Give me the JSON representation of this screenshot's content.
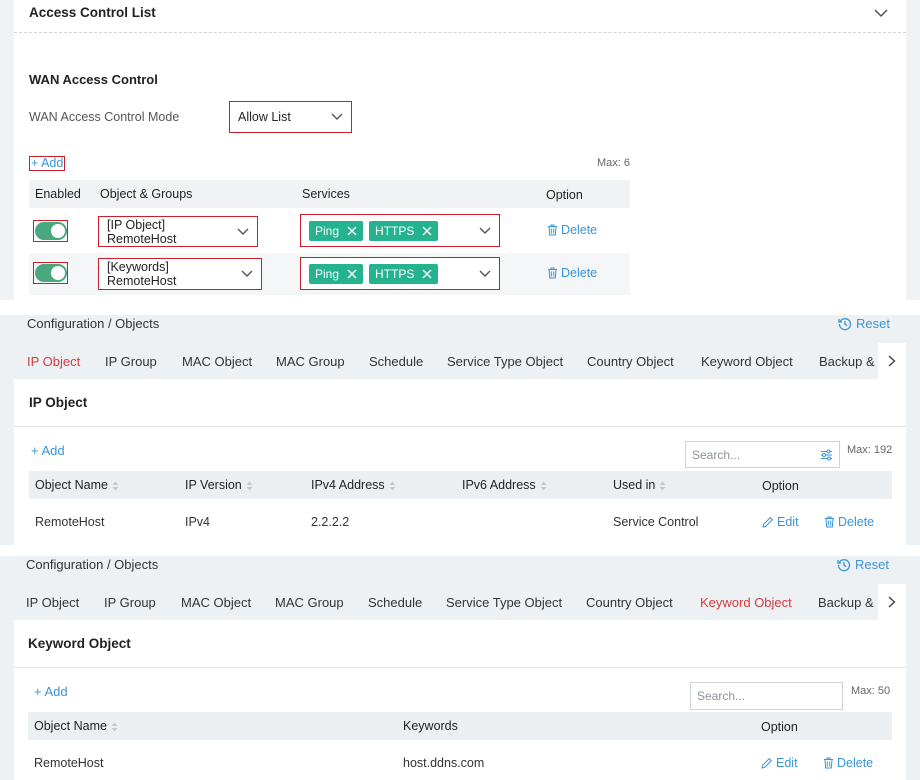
{
  "acl": {
    "title": "Access Control List",
    "section_title": "WAN Access Control",
    "mode_label": "WAN Access Control Mode",
    "mode_value": "Allow List",
    "add_label": "+ Add",
    "max_label": "Max: 6",
    "headers": [
      "Enabled",
      "Object & Groups",
      "Services",
      "Option"
    ],
    "rows": [
      {
        "object": "[IP Object] RemoteHost",
        "services": [
          "Ping",
          "HTTPS"
        ],
        "delete": "Delete"
      },
      {
        "object": "[Keywords] RemoteHost",
        "services": [
          "Ping",
          "HTTPS"
        ],
        "delete": "Delete"
      }
    ]
  },
  "ip_page": {
    "breadcrumb": "Configuration / Objects",
    "reset": "Reset",
    "tabs": [
      "IP Object",
      "IP Group",
      "MAC Object",
      "MAC Group",
      "Schedule",
      "Service Type Object",
      "Country Object",
      "Keyword Object",
      "Backup & I"
    ],
    "section_title": "IP Object",
    "add_label": "+ Add",
    "search_placeholder": "Search...",
    "max_label": "Max: 192",
    "headers": [
      "Object Name",
      "IP Version",
      "IPv4 Address",
      "IPv6 Address",
      "Used in",
      "Option"
    ],
    "rows": [
      {
        "name": "RemoteHost",
        "version": "IPv4",
        "ipv4": "2.2.2.2",
        "ipv6": "",
        "used_in": "Service Control",
        "edit": "Edit",
        "delete": "Delete"
      }
    ]
  },
  "kw_page": {
    "breadcrumb": "Configuration / Objects",
    "reset": "Reset",
    "tabs": [
      "IP Object",
      "IP Group",
      "MAC Object",
      "MAC Group",
      "Schedule",
      "Service Type Object",
      "Country Object",
      "Keyword Object",
      "Backup & I"
    ],
    "section_title": "Keyword Object",
    "add_label": "+ Add",
    "search_placeholder": "Search...",
    "max_label": "Max: 50",
    "headers": [
      "Object Name",
      "Keywords",
      "Option"
    ],
    "rows": [
      {
        "name": "RemoteHost",
        "keywords": "host.ddns.com",
        "edit": "Edit",
        "delete": "Delete"
      }
    ]
  },
  "colors": {
    "accent": "#3a95d6",
    "tab_active": "#d33b3f",
    "toggle_on": "#4aa87f",
    "tag": "#25b28e",
    "highlight": "#c81e2d"
  }
}
